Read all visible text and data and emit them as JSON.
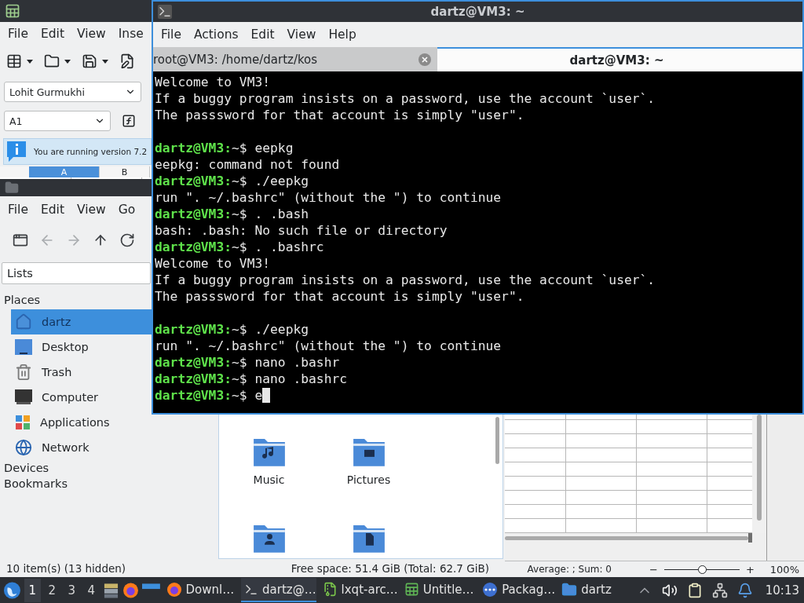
{
  "spreadsheet": {
    "menu": [
      "File",
      "Edit",
      "View",
      "Inse"
    ],
    "font_name": "Lohit Gurmukhi",
    "cell_reference": "A1",
    "info_message": "You are running version 7.2",
    "columns": [
      {
        "label": "A",
        "selected": true
      },
      {
        "label": "B",
        "selected": false
      }
    ],
    "status": "Average: ; Sum: 0",
    "zoom": {
      "out": "−",
      "in": "+",
      "level": 0.5,
      "reading": "100%"
    }
  },
  "file_manager": {
    "menu": [
      "File",
      "Edit",
      "View",
      "Go"
    ],
    "toolbar": [
      {
        "kind": "new-tab",
        "disabled": false
      },
      {
        "kind": "back",
        "disabled": true
      },
      {
        "kind": "forward",
        "disabled": true
      },
      {
        "kind": "up",
        "disabled": false
      },
      {
        "kind": "reload",
        "disabled": false
      }
    ],
    "side_pane_mode": "Lists",
    "places_header": "Places",
    "places": [
      {
        "label": "dartz",
        "kind": "home",
        "selected": true
      },
      {
        "label": "Desktop",
        "kind": "desktop",
        "selected": false
      },
      {
        "label": "Trash",
        "kind": "trash",
        "selected": false
      },
      {
        "label": "Computer",
        "kind": "computer",
        "selected": false
      },
      {
        "label": "Applications",
        "kind": "applications",
        "selected": false
      },
      {
        "label": "Network",
        "kind": "network",
        "selected": false
      }
    ],
    "sections": [
      "Devices",
      "Bookmarks"
    ],
    "items": [
      {
        "label": "Music",
        "kind": "music"
      },
      {
        "label": "Pictures",
        "kind": "pictures"
      },
      {
        "kind": "user"
      },
      {
        "kind": "document"
      }
    ],
    "status": "10 item(s) (13 hidden)",
    "free_space": "Free space: 51.4 GiB (Total: 62.7 GiB)"
  },
  "terminal": {
    "title": "dartz@VM3: ~",
    "menu": [
      "File",
      "Actions",
      "Edit",
      "View",
      "Help"
    ],
    "tabs": [
      {
        "label": "root@VM3: /home/dartz/kos",
        "selected": false
      },
      {
        "label": "dartz@VM3: ~",
        "selected": true
      }
    ],
    "lines": [
      {
        "kind": "output",
        "text": "Welcome to VM3!"
      },
      {
        "kind": "output",
        "text": "If a buggy program insists on a password, use the account `user`."
      },
      {
        "kind": "output",
        "text": "The passsword for that account is simply \"user\"."
      },
      {
        "kind": "blank"
      },
      {
        "kind": "prompt",
        "prompt": "dartz@VM3:",
        "path": "~$",
        "command": "eepkg",
        "cursor": false
      },
      {
        "kind": "output",
        "text": "eepkg: command not found"
      },
      {
        "kind": "prompt",
        "prompt": "dartz@VM3:",
        "path": "~$",
        "command": "./eepkg",
        "cursor": false
      },
      {
        "kind": "output",
        "text": "run \". ~/.bashrc\" (without the \") to continue"
      },
      {
        "kind": "prompt",
        "prompt": "dartz@VM3:",
        "path": "~$",
        "command": ". .bash",
        "cursor": false
      },
      {
        "kind": "output",
        "text": "bash: .bash: No such file or directory"
      },
      {
        "kind": "prompt",
        "prompt": "dartz@VM3:",
        "path": "~$",
        "command": ". .bashrc",
        "cursor": false
      },
      {
        "kind": "output",
        "text": "Welcome to VM3!"
      },
      {
        "kind": "output",
        "text": "If a buggy program insists on a password, use the account `user`."
      },
      {
        "kind": "output",
        "text": "The passsword for that account is simply \"user\"."
      },
      {
        "kind": "blank"
      },
      {
        "kind": "prompt",
        "prompt": "dartz@VM3:",
        "path": "~$",
        "command": "./eepkg",
        "cursor": false
      },
      {
        "kind": "output",
        "text": "run \". ~/.bashrc\" (without the \") to continue"
      },
      {
        "kind": "prompt",
        "prompt": "dartz@VM3:",
        "path": "~$",
        "command": "nano .bashr",
        "cursor": false
      },
      {
        "kind": "prompt",
        "prompt": "dartz@VM3:",
        "path": "~$",
        "command": "nano .bashrc",
        "cursor": false
      },
      {
        "kind": "prompt",
        "prompt": "dartz@VM3:",
        "path": "~$",
        "command": "e",
        "cursor": true
      }
    ]
  },
  "taskbar": {
    "desktops": [
      {
        "label": "1",
        "selected": true
      },
      {
        "label": "2",
        "selected": false
      },
      {
        "label": "3",
        "selected": false
      },
      {
        "label": "4",
        "selected": false
      }
    ],
    "tasks": [
      {
        "label": "Downl…",
        "kind": "browser",
        "selected": false
      },
      {
        "label": "dartz@…",
        "kind": "terminal",
        "selected": true
      },
      {
        "label": "lxqt-arc…",
        "kind": "archive",
        "selected": false
      },
      {
        "label": "Untitle…",
        "kind": "sheet",
        "selected": false
      },
      {
        "label": "Packag…",
        "kind": "package",
        "selected": false
      },
      {
        "label": "dartz",
        "kind": "folder",
        "selected": false
      }
    ],
    "clock": "10:13"
  }
}
